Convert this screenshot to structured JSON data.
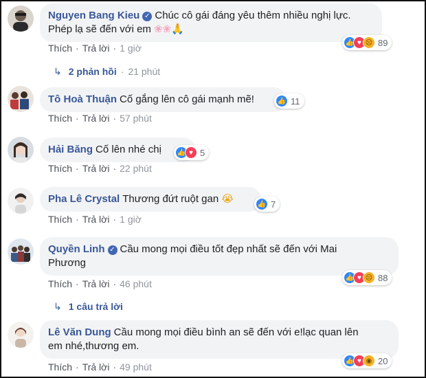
{
  "ui": {
    "like_label": "Thích",
    "reply_label": "Trả lời",
    "dot": "·"
  },
  "colors": {
    "name": "#385898",
    "bubble": "#f2f3f5",
    "like": "#2d88ff",
    "love": "#f33e58",
    "sad": "#f7b125",
    "verified": "#4267b2"
  },
  "comments": [
    {
      "name": "Nguyen Bang Kieu",
      "verified": true,
      "text_line1": "Chúc cô gái đáng yêu thêm nhiều nghị lực.",
      "text_line2": "Phép lạ sẽ đến với em",
      "emoji": [
        "cherry-blossom-icon",
        "cherry-blossom-icon",
        "folded-hands-icon"
      ],
      "time": "1 giờ",
      "reactions": [
        "like",
        "love",
        "sad"
      ],
      "reaction_count": "89",
      "replies": {
        "label": "2 phản hồi",
        "time": "21 phút"
      }
    },
    {
      "name": "Tô Hoà Thuận",
      "verified": false,
      "text_line1": "Cố gắng lên cô gái mạnh mẽ!",
      "time": "57 phút",
      "reactions": [
        "like"
      ],
      "reaction_count": "11"
    },
    {
      "name": "Hải Băng",
      "verified": false,
      "text_line1": "Cố lên nhé chị",
      "time": "22 phút",
      "reactions": [
        "like",
        "love"
      ],
      "reaction_count": "5"
    },
    {
      "name": "Pha Lê Crystal",
      "verified": false,
      "text_line1": "Thương đứt ruột gan",
      "emoji": [
        "crying-face-icon"
      ],
      "time": "1 giờ",
      "reactions": [
        "like"
      ],
      "reaction_count": "7"
    },
    {
      "name": "Quyền Linh",
      "verified": true,
      "text_line1": "Cầu mong mọi điều tốt đẹp nhất sẽ đến với Mai",
      "text_line2": "Phương",
      "time": "46 phút",
      "reactions": [
        "like",
        "love",
        "sad"
      ],
      "reaction_count": "88",
      "replies": {
        "label": "1 câu trả lời"
      }
    },
    {
      "name": "Lê Văn Dung",
      "verified": false,
      "text_line1": "Cầu mong mọi điều bình an sẽ đến với e!lạc quan lên",
      "text_line2": "em nhé,thương em.",
      "time": "49 phút",
      "reactions": [
        "like",
        "love",
        "wow"
      ],
      "reaction_count": "20"
    }
  ]
}
